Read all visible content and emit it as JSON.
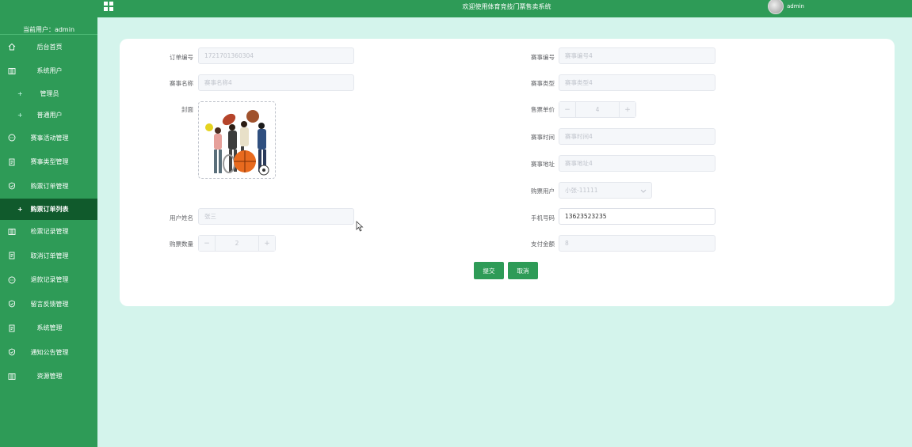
{
  "header": {
    "title": "欢迎使用体育竞技门票售卖系统",
    "admin_name": "admin"
  },
  "sidebar": {
    "avatar_alt": "avatar",
    "current_user": "当前用户：admin",
    "items": [
      {
        "label": "后台首页",
        "icon": "home-icon"
      },
      {
        "label": "系统用户",
        "icon": "columns-icon"
      },
      {
        "label": "管理员",
        "sub": true
      },
      {
        "label": "普通用户",
        "sub": true
      },
      {
        "label": "赛事活动管理",
        "icon": "chat-icon"
      },
      {
        "label": "赛事类型管理",
        "icon": "document-icon"
      },
      {
        "label": "购票订单管理",
        "icon": "shield-icon"
      },
      {
        "label": "购票订单列表",
        "sub": true,
        "active": true
      },
      {
        "label": "检票记录管理",
        "icon": "columns-icon"
      },
      {
        "label": "取消订单管理",
        "icon": "document-icon"
      },
      {
        "label": "退款记录管理",
        "icon": "chat-icon"
      },
      {
        "label": "留言反馈管理",
        "icon": "shield-icon"
      },
      {
        "label": "系统管理",
        "icon": "document-icon"
      },
      {
        "label": "通知公告管理",
        "icon": "shield-icon"
      },
      {
        "label": "资源管理",
        "icon": "columns-icon"
      }
    ]
  },
  "form": {
    "order_no_label": "订单编号",
    "order_no_value": "1721701360304",
    "event_no_label": "赛事编号",
    "event_no_placeholder": "赛事编号4",
    "event_name_label": "赛事名称",
    "event_name_placeholder": "赛事名称4",
    "event_type_label": "赛事类型",
    "event_type_placeholder": "赛事类型4",
    "cover_label": "封面",
    "ticket_price_label": "售票单价",
    "ticket_price_value": "4",
    "event_time_label": "赛事时间",
    "event_time_placeholder": "赛事时间4",
    "event_address_label": "赛事地址",
    "event_address_placeholder": "赛事地址4",
    "buyer_label": "购票用户",
    "buyer_value": "小张-11111",
    "user_name_label": "用户姓名",
    "user_name_value": "张三",
    "phone_label": "手机号码",
    "phone_value": "13623523235",
    "quantity_label": "购票数量",
    "quantity_value": "2",
    "amount_label": "支付金额",
    "amount_value": "8",
    "submit_label": "提交",
    "cancel_label": "取消"
  },
  "colors": {
    "brand_green": "#2e9b57",
    "active_menu": "#105a2c",
    "page_bg": "#d4f4ec"
  }
}
